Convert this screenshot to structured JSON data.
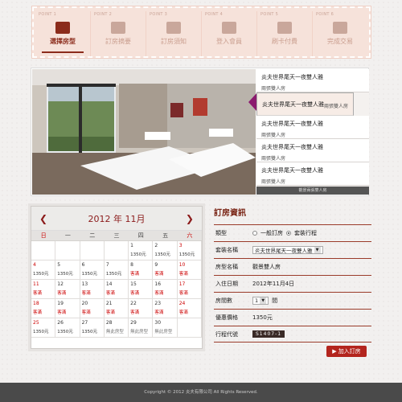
{
  "steps": [
    {
      "point": "POINT 1",
      "label": "選擇房型",
      "active": true
    },
    {
      "point": "POINT 2",
      "label": "訂房摘要",
      "active": false
    },
    {
      "point": "POINT 3",
      "label": "訂房須知",
      "active": false
    },
    {
      "point": "POINT 4",
      "label": "登入會員",
      "active": false
    },
    {
      "point": "POINT 5",
      "label": "刷卡付費",
      "active": false
    },
    {
      "point": "POINT 6",
      "label": "完成交易",
      "active": false
    }
  ],
  "rooms": [
    {
      "title": "炎夫世界尾天一夜雙人雅",
      "sub": "兩張雙人房",
      "selected": false
    },
    {
      "title": "炎夫世界尾天一夜雙人雅",
      "sub": "兩張雙人房",
      "selected": true
    },
    {
      "title": "炎夫世界尾天一夜雙人雅",
      "sub": "兩張雙人房",
      "selected": false
    },
    {
      "title": "炎夫世界尾天一夜雙人雅",
      "sub": "兩張雙人房",
      "selected": false
    },
    {
      "title": "炎夫世界尾天一夜雙人雅",
      "sub": "兩張雙人房",
      "selected": false
    }
  ],
  "rooms_caption": "觀景兩張雙人房",
  "calendar": {
    "title": "2012 年 11月",
    "prev": "❮",
    "next": "❯",
    "dow": [
      "日",
      "一",
      "二",
      "三",
      "四",
      "五",
      "六"
    ],
    "cells": [
      {
        "d": "",
        "t": "",
        "k": ""
      },
      {
        "d": "",
        "t": "",
        "k": ""
      },
      {
        "d": "",
        "t": "",
        "k": ""
      },
      {
        "d": "",
        "t": "",
        "k": ""
      },
      {
        "d": "1",
        "t": "1350元",
        "k": "p"
      },
      {
        "d": "2",
        "t": "1350元",
        "k": "p"
      },
      {
        "d": "3",
        "t": "1350元",
        "k": "p",
        "red": true
      },
      {
        "d": "4",
        "t": "1350元",
        "k": "p",
        "red": true
      },
      {
        "d": "5",
        "t": "1350元",
        "k": "p"
      },
      {
        "d": "6",
        "t": "1350元",
        "k": "p"
      },
      {
        "d": "7",
        "t": "1350元",
        "k": "p"
      },
      {
        "d": "8",
        "t": "客滿",
        "k": "f"
      },
      {
        "d": "9",
        "t": "客滿",
        "k": "f"
      },
      {
        "d": "10",
        "t": "客滿",
        "k": "f",
        "red": true
      },
      {
        "d": "11",
        "t": "客滿",
        "k": "f",
        "red": true
      },
      {
        "d": "12",
        "t": "客滿",
        "k": "f"
      },
      {
        "d": "13",
        "t": "客滿",
        "k": "f"
      },
      {
        "d": "14",
        "t": "客滿",
        "k": "f"
      },
      {
        "d": "15",
        "t": "客滿",
        "k": "f"
      },
      {
        "d": "16",
        "t": "客滿",
        "k": "f"
      },
      {
        "d": "17",
        "t": "客滿",
        "k": "f",
        "red": true
      },
      {
        "d": "18",
        "t": "客滿",
        "k": "f",
        "red": true
      },
      {
        "d": "19",
        "t": "客滿",
        "k": "f"
      },
      {
        "d": "20",
        "t": "客滿",
        "k": "f"
      },
      {
        "d": "21",
        "t": "客滿",
        "k": "f"
      },
      {
        "d": "22",
        "t": "客滿",
        "k": "f"
      },
      {
        "d": "23",
        "t": "客滿",
        "k": "f"
      },
      {
        "d": "24",
        "t": "客滿",
        "k": "f",
        "red": true
      },
      {
        "d": "25",
        "t": "1350元",
        "k": "p",
        "red": true
      },
      {
        "d": "26",
        "t": "1350元",
        "k": "p"
      },
      {
        "d": "27",
        "t": "1350元",
        "k": "p"
      },
      {
        "d": "28",
        "t": "無此房型",
        "k": "n"
      },
      {
        "d": "29",
        "t": "無此房型",
        "k": "n"
      },
      {
        "d": "30",
        "t": "無此房型",
        "k": "n"
      },
      {
        "d": "",
        "t": "",
        "k": ""
      }
    ]
  },
  "form": {
    "title": "訂房資訊",
    "type_label": "類型",
    "opt_single": "一般訂房",
    "opt_pkg": "套裝行程",
    "pkg_label": "套裝名稱",
    "pkg_value": "炎夫世界尾天一夜雙人雅",
    "room_label": "房型名稱",
    "room_value": "觀景雙人房",
    "date_label": "入住日期",
    "date_value": "2012年11月4日",
    "rooms_label": "房間數",
    "rooms_value": "1",
    "rooms_unit": "間",
    "price_label": "優惠價格",
    "price_value": "1350元",
    "code_label": "行程代號",
    "code_value": "S1407-1",
    "add_button": "加入訂房"
  },
  "footer": "Copyright © 2012 炎夫有限公司 All Rights Reserved."
}
